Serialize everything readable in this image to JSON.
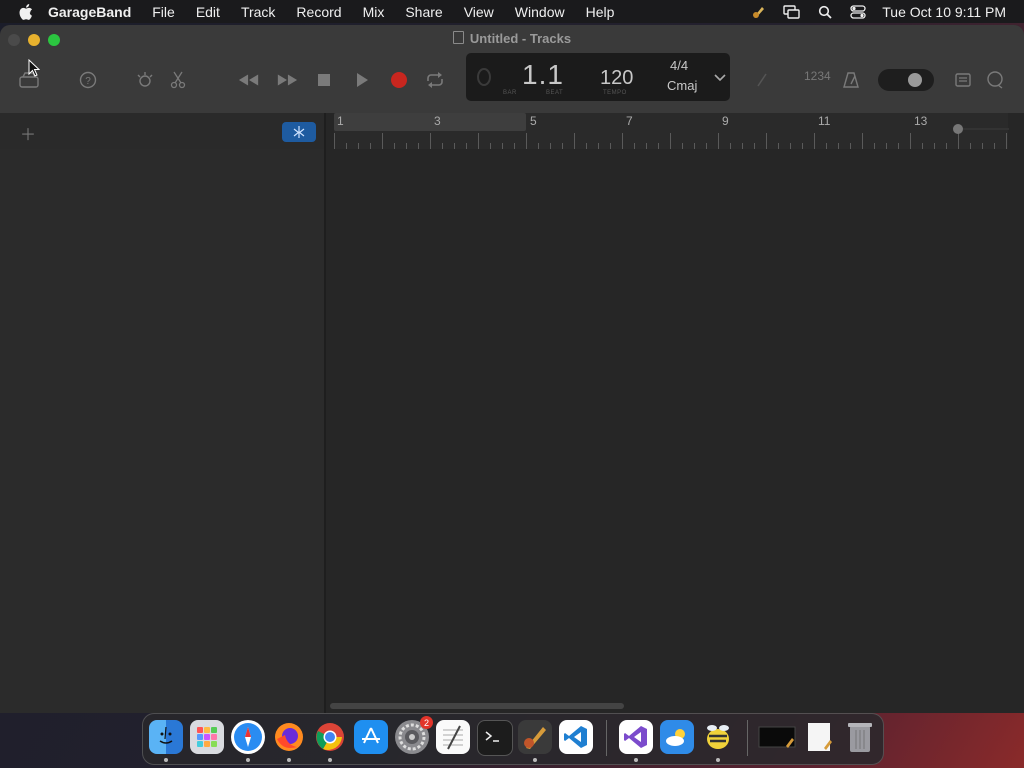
{
  "menubar": {
    "app_name": "GarageBand",
    "items": [
      "File",
      "Edit",
      "Track",
      "Record",
      "Mix",
      "Share",
      "View",
      "Window",
      "Help"
    ],
    "clock": "Tue Oct 10  9:11 PM",
    "status_icons": [
      "garageband-status-icon",
      "screen-mirroring-icon",
      "spotlight-search-icon",
      "control-center-icon"
    ]
  },
  "window": {
    "title": "Untitled - Tracks"
  },
  "toolbar": {
    "icons": [
      "library-icon",
      "quick-help-icon",
      "smart-controls-icon",
      "editors-icon",
      "rewind-icon",
      "fast-forward-icon",
      "stop-icon",
      "play-icon",
      "record-icon",
      "cycle-icon",
      "tuner-icon",
      "count-in-icon",
      "metronome-icon",
      "note-pad-icon",
      "loop-browser-icon"
    ],
    "count_in": "1234"
  },
  "lcd": {
    "position": "1.1",
    "bar_label": "BAR",
    "beat_label": "BEAT",
    "tempo": "120",
    "tempo_label": "TEMPO",
    "time_signature": "4/4",
    "key": "Cmaj"
  },
  "ruler": {
    "bars": [
      "1",
      "3",
      "5",
      "7",
      "9",
      "11",
      "13"
    ]
  },
  "colors": {
    "record": "#c8261f",
    "smart_button": "#1e5ba0",
    "close": "#4a4a4a",
    "minimize": "#e7b12e",
    "maximize": "#2bc540"
  },
  "dock": {
    "apps": [
      "Finder",
      "Launchpad",
      "Safari",
      "Firefox",
      "Google Chrome",
      "App Store",
      "System Settings",
      "TextEdit",
      "Terminal",
      "GarageBand",
      "Visual Studio Code",
      "Visual Studio",
      "Weather",
      "Cyberduck",
      "Preview",
      "Notes",
      "Trash"
    ],
    "settings_badge": "2"
  }
}
